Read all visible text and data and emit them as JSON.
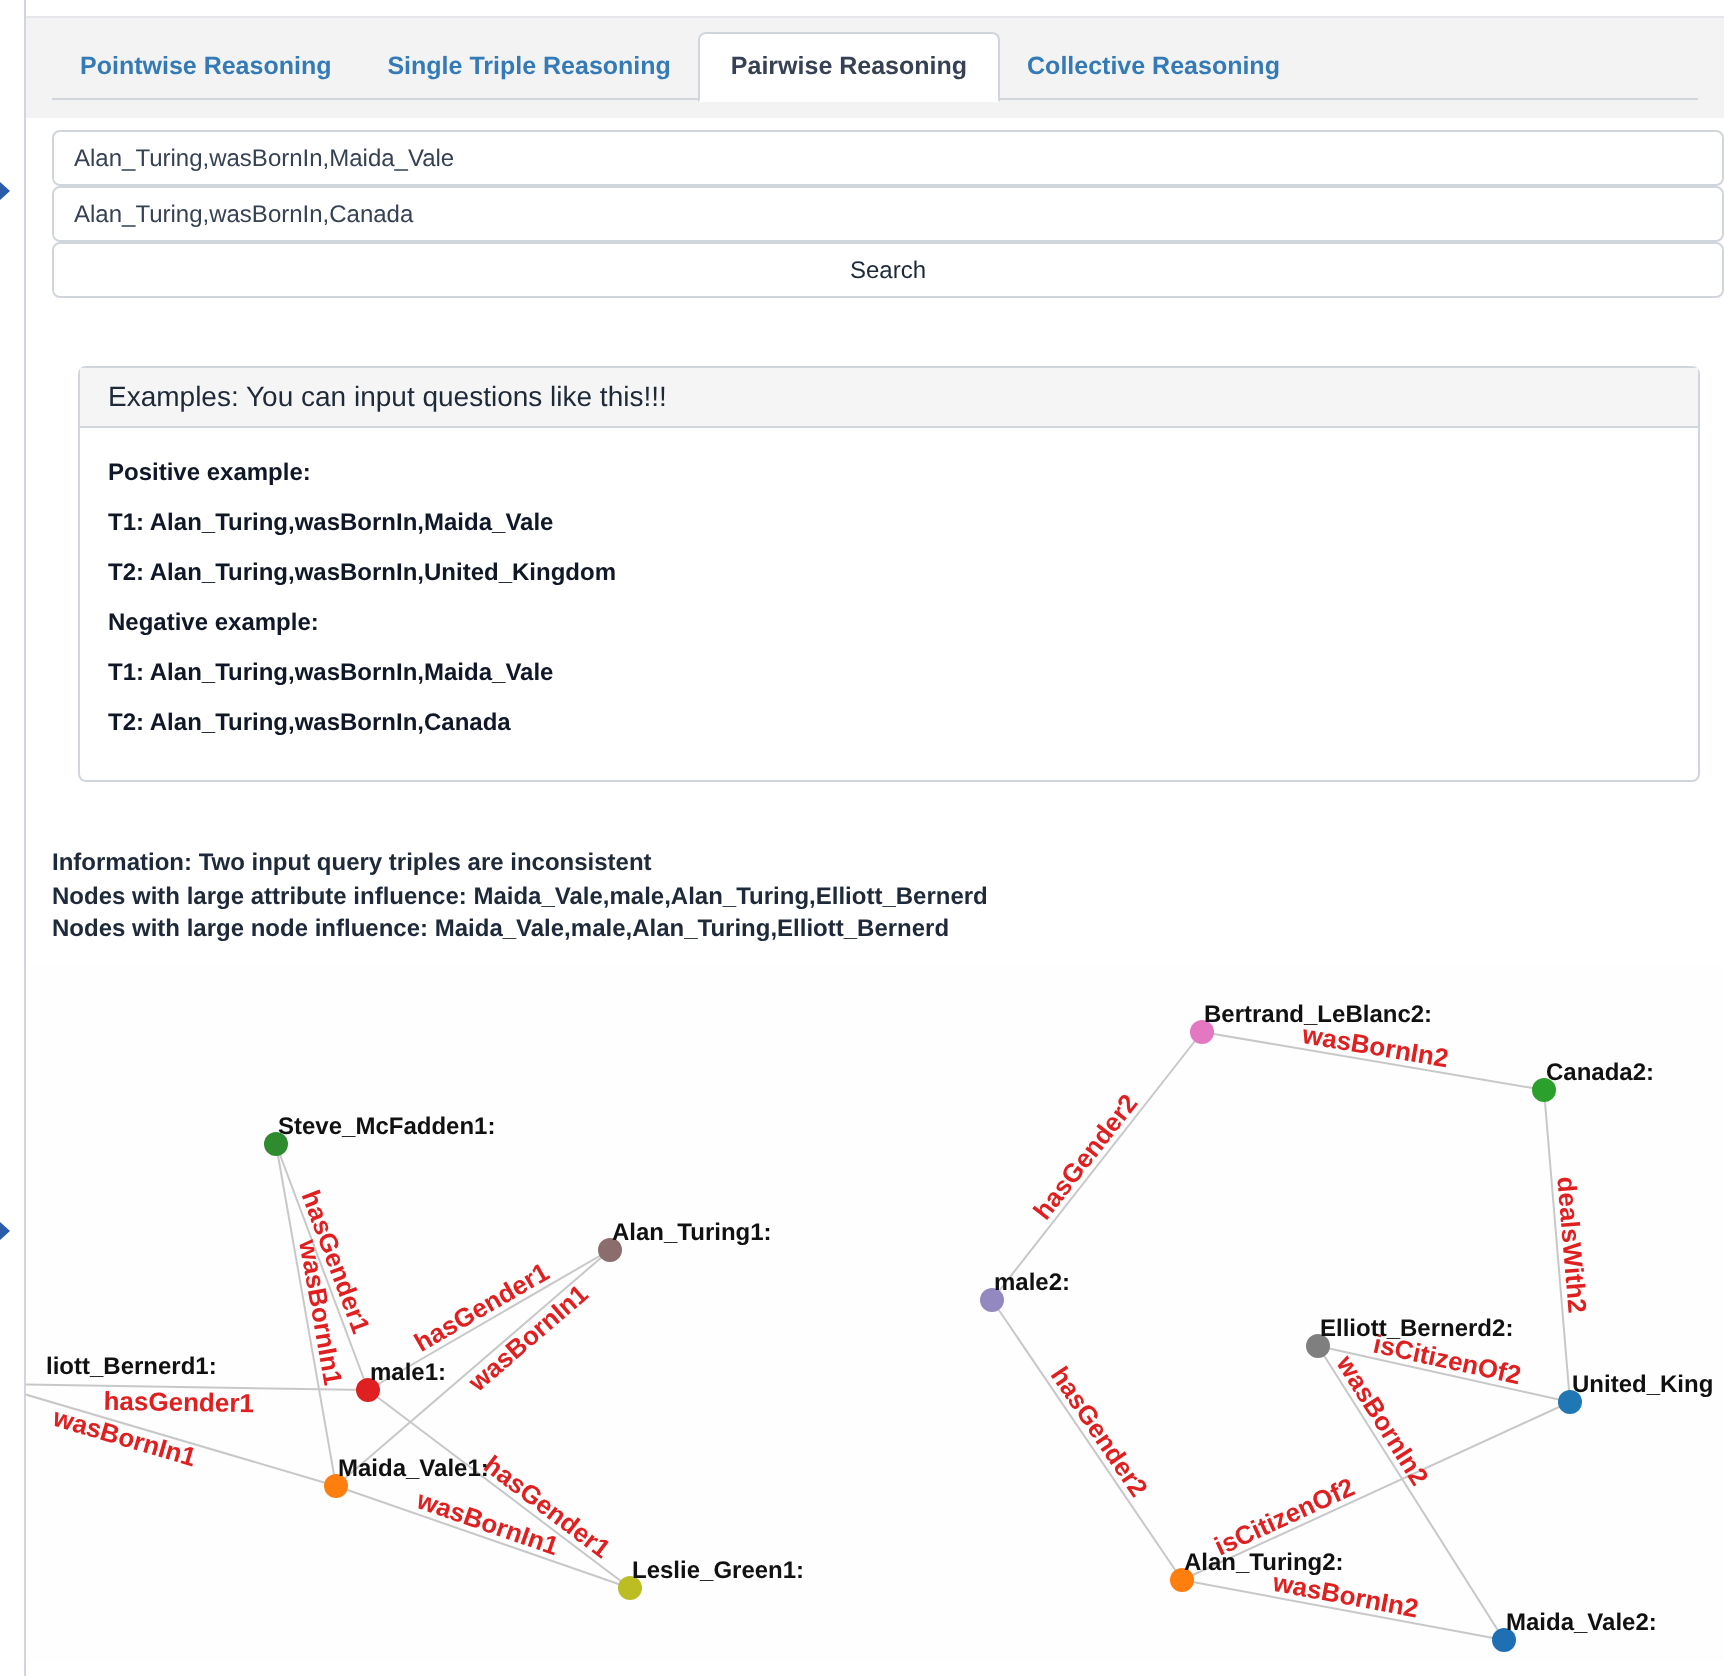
{
  "tabs": [
    {
      "label": "Pointwise Reasoning",
      "selected": false
    },
    {
      "label": "Single Triple Reasoning",
      "selected": false
    },
    {
      "label": "Pairwise Reasoning",
      "selected": true
    },
    {
      "label": "Collective Reasoning",
      "selected": false
    }
  ],
  "queries": [
    {
      "value": "Alan_Turing,wasBornIn,Maida_Vale"
    },
    {
      "value": "Alan_Turing,wasBornIn,Canada"
    }
  ],
  "search_button": "Search",
  "examples": {
    "title": "Examples: You can input questions like this!!!",
    "lines": [
      "Positive example:",
      "T1: Alan_Turing,wasBornIn,Maida_Vale",
      "T2: Alan_Turing,wasBornIn,United_Kingdom",
      "Negative example:",
      "T1: Alan_Turing,wasBornIn,Maida_Vale",
      "T2: Alan_Turing,wasBornIn,Canada"
    ]
  },
  "information": [
    "Information: Two input query triples are inconsistent",
    "Nodes with large attribute influence: Maida_Vale,male,Alan_Turing,Elliott_Bernerd",
    "Nodes with large node influence: Maida_Vale,male,Alan_Turing,Elliott_Bernerd"
  ],
  "graphs": [
    {
      "nodes": [
        {
          "label": "Steve_McFadden1:",
          "color": "#2e8b2e"
        },
        {
          "label": "Alan_Turing1:",
          "color": "#8c6d6d"
        },
        {
          "label": "male1:",
          "color": "#e02020"
        },
        {
          "label": "liott_Bernerd1:"
        },
        {
          "label": "Maida_Vale1:",
          "color": "#ff7f0e"
        },
        {
          "label": "Leslie_Green1:",
          "color": "#bcbd22"
        }
      ],
      "edges": [
        {
          "label": "hasGender1"
        },
        {
          "label": "wasBornIn1"
        },
        {
          "label": "hasGender1"
        },
        {
          "label": "wasBornIn1"
        },
        {
          "label": "hasGender1"
        },
        {
          "label": "wasBornIn1"
        },
        {
          "label": "hasGender1"
        },
        {
          "label": "wasBornIn1"
        }
      ]
    },
    {
      "nodes": [
        {
          "label": "Bertrand_LeBlanc2:",
          "color": "#e377c2"
        },
        {
          "label": "Canada2:",
          "color": "#2ca02c"
        },
        {
          "label": "male2:",
          "color": "#9488c0"
        },
        {
          "label": "Elliott_Bernerd2:",
          "color": "#7f7f7f"
        },
        {
          "label": "United_King",
          "color": "#1f77b4"
        },
        {
          "label": "Alan_Turing2:",
          "color": "#ff7f0e"
        },
        {
          "label": "Maida_Vale2:",
          "color": "#1f6fb4"
        }
      ],
      "edges": [
        {
          "label": "wasBornIn2"
        },
        {
          "label": "hasGender2"
        },
        {
          "label": "dealsWith2"
        },
        {
          "label": "hasGender2"
        },
        {
          "label": "isCitizenOf2"
        },
        {
          "label": "wasBornIn2"
        },
        {
          "label": "isCitizenOf2"
        },
        {
          "label": "wasBornIn2"
        }
      ]
    }
  ]
}
